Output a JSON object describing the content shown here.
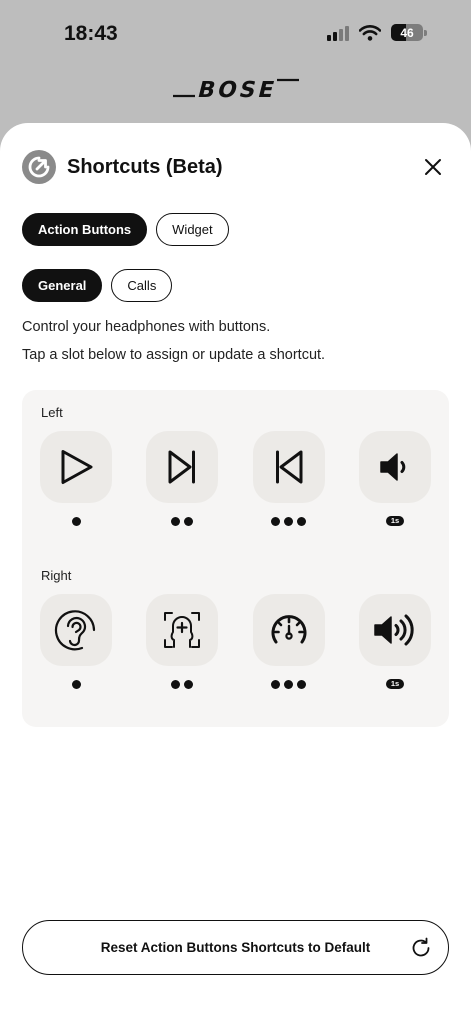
{
  "status_bar": {
    "time": "18:43",
    "battery": "46"
  },
  "brand": {
    "logo_text": "BOSE"
  },
  "header": {
    "title": "Shortcuts (Beta)",
    "icon": "shortcut-arrow-icon",
    "close_icon": "close-icon"
  },
  "tabs": [
    {
      "label": "Action Buttons",
      "selected": true
    },
    {
      "label": "Widget",
      "selected": false
    }
  ],
  "subtabs": [
    {
      "label": "General",
      "selected": true
    },
    {
      "label": "Calls",
      "selected": false
    }
  ],
  "description": {
    "line1": "Control your headphones with buttons.",
    "line2": "Tap a slot below to assign or update a shortcut."
  },
  "left": {
    "label": "Left",
    "slots": [
      {
        "icon": "play-icon",
        "gesture": "single-press"
      },
      {
        "icon": "skip-forward-icon",
        "gesture": "double-press"
      },
      {
        "icon": "skip-back-icon",
        "gesture": "triple-press"
      },
      {
        "icon": "volume-down-icon",
        "gesture": "hold",
        "hold_label": "1s"
      }
    ]
  },
  "right": {
    "label": "Right",
    "slots": [
      {
        "icon": "ear-icon",
        "gesture": "single-press"
      },
      {
        "icon": "face-add-icon",
        "gesture": "double-press"
      },
      {
        "icon": "gauge-icon",
        "gesture": "triple-press"
      },
      {
        "icon": "volume-up-icon",
        "gesture": "hold",
        "hold_label": "1s"
      }
    ]
  },
  "reset_button": {
    "label": "Reset Action Buttons Shortcuts to Default",
    "icon": "refresh-icon"
  },
  "colors": {
    "backdrop": "#bdbdbd",
    "sheet": "#ffffff",
    "panel": "#f6f5f4",
    "slot": "#eceae7",
    "accent": "#111111"
  }
}
